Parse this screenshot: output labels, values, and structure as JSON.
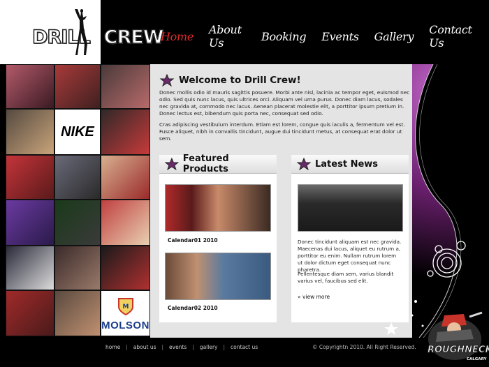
{
  "logo": {
    "left": "DRILL",
    "right": "CREW"
  },
  "nav": [
    {
      "label": "Home",
      "active": true
    },
    {
      "label": "About Us",
      "active": false
    },
    {
      "label": "Booking",
      "active": false
    },
    {
      "label": "Events",
      "active": false
    },
    {
      "label": "Gallery",
      "active": false
    },
    {
      "label": "Contact Us",
      "active": false
    }
  ],
  "sponsors": {
    "nike": "NIKE",
    "molson": "MOLSON"
  },
  "welcome": {
    "title": "Welcome to Drill Crew!",
    "p1": "Donec mollis odio id mauris sagittis posuere. Morbi ante nisl, lacinia ac tempor eget, euismod nec odio. Sed quis nunc lacus, quis ultrices orci. Aliquam vel urna purus. Donec diam lacus, sodales nec gravida at, commodo nec lacus. Aenean placerat molestie elit, a porttitor ipsum pretium in. Donec lectus est, bibendum quis porta nec, consequat sed odio.",
    "p2": "Cras adipiscing vestibulum interdum. Etiam est lorem, congue quis iaculis a, fermentum vel est. Fusce aliquet, nibh in convallis tincidunt, augue dui tincidunt metus, at consequat erat dolor ut sem."
  },
  "featured": {
    "title": "Featured Products",
    "items": [
      {
        "caption": "Calendar01 2010"
      },
      {
        "caption": "Calendar02 2010"
      }
    ]
  },
  "news": {
    "title": "Latest News",
    "p1": "Donec tincidunt aliquam est nec gravida. Maecenas dui lacus, aliquet eu rutrum a, porttitor eu enim. Nullam rutrum lorem ut dolor dictum eget consequat nunc pharetra.",
    "p2": "Pellentesque diam sem, varius blandit varius vel, faucibus sed elit.",
    "more": "»  view more"
  },
  "footer": {
    "links": [
      "home",
      "about us",
      "events",
      "gallery",
      "contact us"
    ],
    "copyright": "© Copyrightn 2010. All Right Reserved."
  },
  "partner": {
    "name": "ROUGHNECKS",
    "sub": "CALGARY"
  },
  "colors": {
    "accent": "#e02a2a",
    "panel": "#e4e4e4",
    "background": "#000000"
  }
}
